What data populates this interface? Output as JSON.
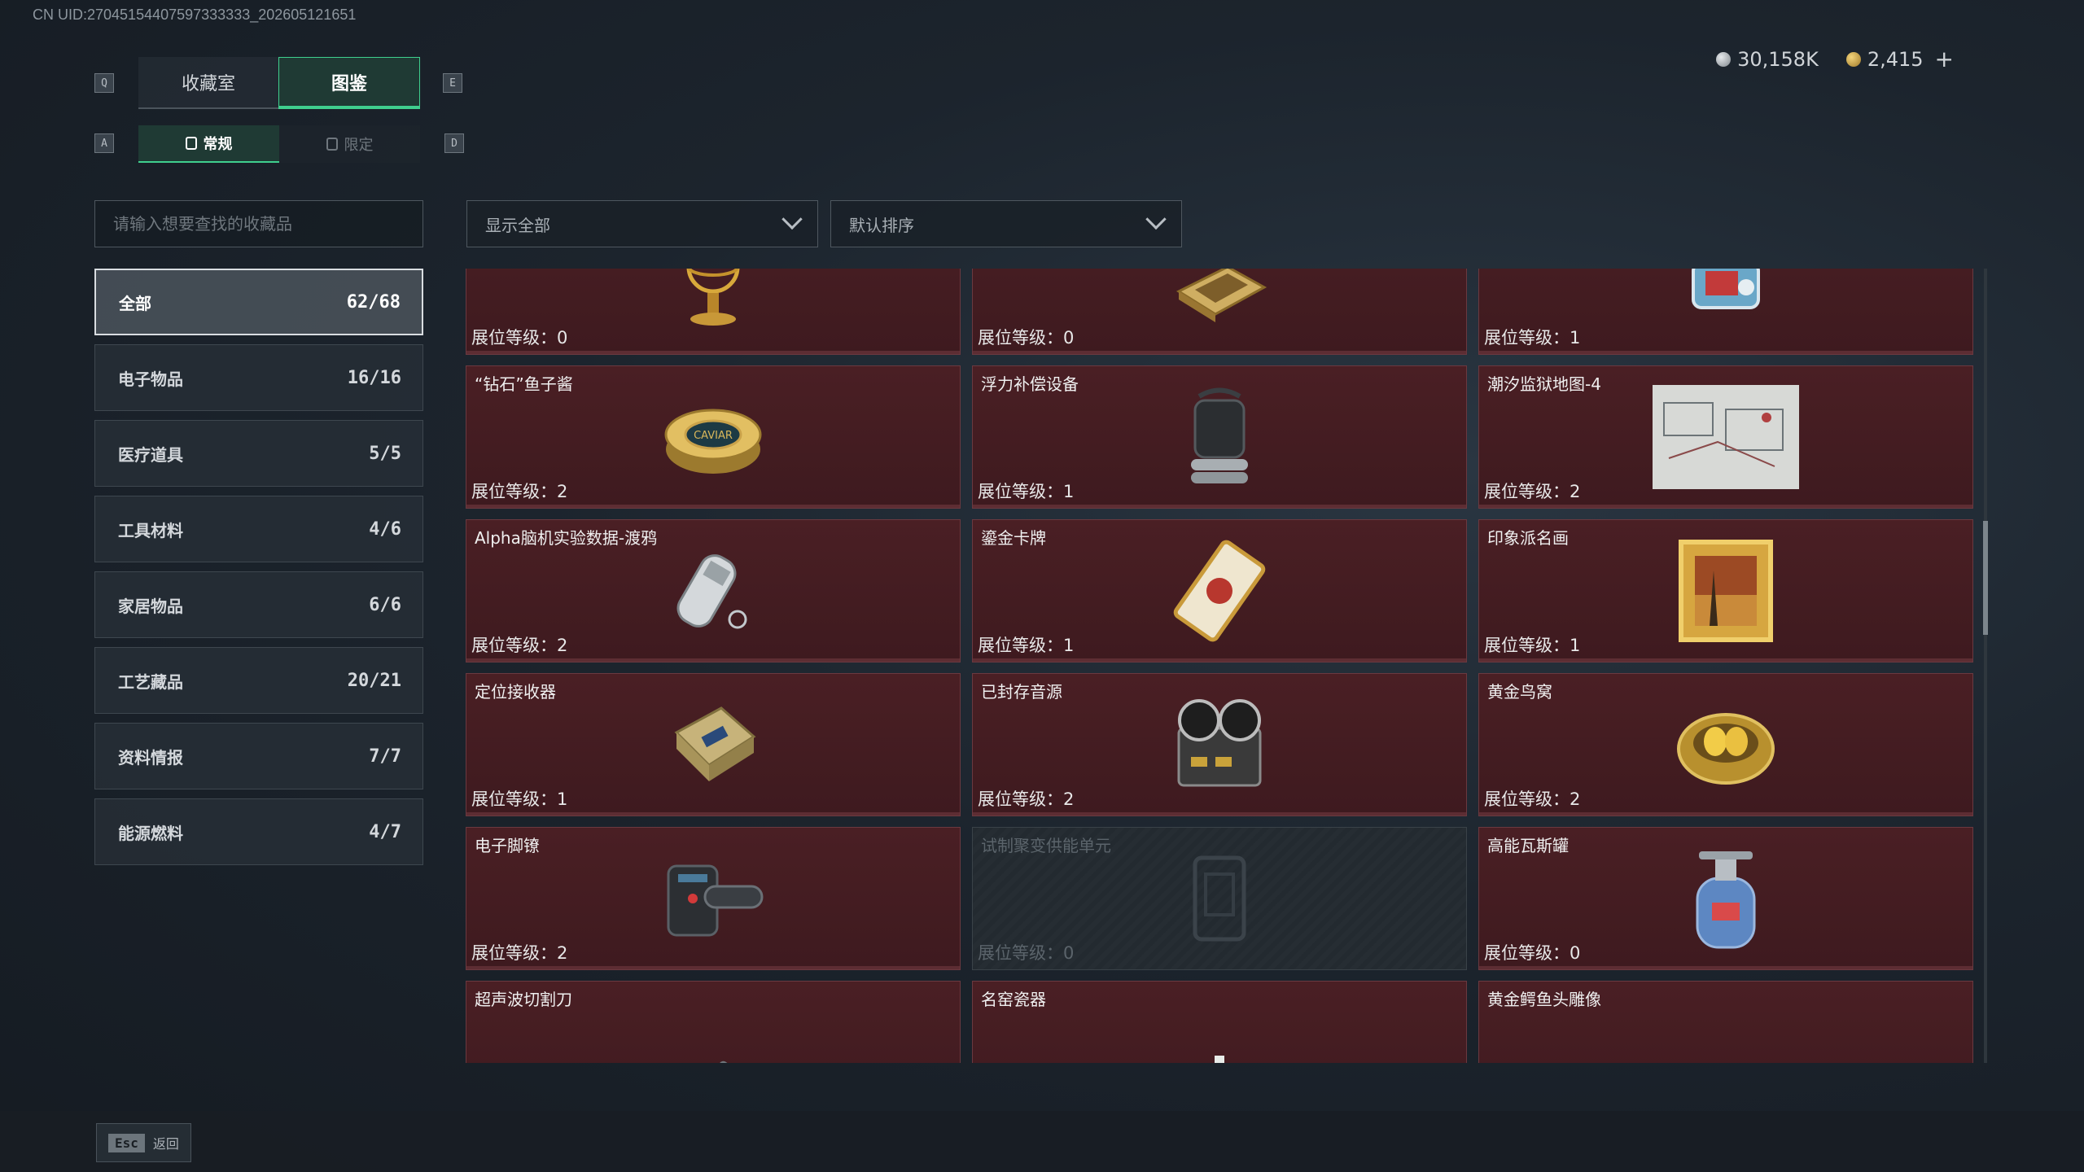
{
  "uid_text": "CN UID:27045154407597333333_202605121651",
  "keys": {
    "prev_tab": "Q",
    "next_tab": "E",
    "prev_sub": "A",
    "next_sub": "D"
  },
  "tabs": [
    {
      "label": "收藏室",
      "active": false
    },
    {
      "label": "图鉴",
      "active": true
    }
  ],
  "subtabs": [
    {
      "label": "常规",
      "active": true
    },
    {
      "label": "限定",
      "active": false
    }
  ],
  "currency": {
    "silver": "30,158K",
    "gold": "2,415",
    "add": "+"
  },
  "search": {
    "placeholder": "请输入想要查找的收藏品"
  },
  "filters": {
    "show": "显示全部",
    "sort": "默认排序"
  },
  "categories": [
    {
      "label": "全部",
      "count": "62/68",
      "active": true
    },
    {
      "label": "电子物品",
      "count": "16/16"
    },
    {
      "label": "医疗道具",
      "count": "5/5"
    },
    {
      "label": "工具材料",
      "count": "4/6"
    },
    {
      "label": "家居物品",
      "count": "6/6"
    },
    {
      "label": "工艺藏品",
      "count": "20/21"
    },
    {
      "label": "资料情报",
      "count": "7/7"
    },
    {
      "label": "能源燃料",
      "count": "4/7"
    }
  ],
  "level_prefix": "展位等级：",
  "items": [
    {
      "name": "",
      "level": "0",
      "icon": "armillary-sphere-icon"
    },
    {
      "name": "",
      "level": "0",
      "icon": "chess-board-icon"
    },
    {
      "name": "",
      "level": "1",
      "icon": "machine-icon"
    },
    {
      "name": "“钻石”鱼子酱",
      "level": "2",
      "icon": "caviar-tin-icon",
      "tin_label": "CAVIAR"
    },
    {
      "name": "浮力补偿设备",
      "level": "1",
      "icon": "bcd-vest-icon"
    },
    {
      "name": "潮汐监狱地图-4",
      "level": "2",
      "icon": "map-icon"
    },
    {
      "name": "Alpha脑机实验数据-渡鸦",
      "level": "2",
      "icon": "data-cylinder-icon"
    },
    {
      "name": "鎏金卡牌",
      "level": "1",
      "icon": "gold-card-icon"
    },
    {
      "name": "印象派名画",
      "level": "1",
      "icon": "framed-painting-icon"
    },
    {
      "name": "定位接收器",
      "level": "1",
      "icon": "receiver-icon"
    },
    {
      "name": "已封存音源",
      "level": "2",
      "icon": "reel-recorder-icon"
    },
    {
      "name": "黄金鸟窝",
      "level": "2",
      "icon": "golden-nest-icon"
    },
    {
      "name": "电子脚镣",
      "level": "2",
      "icon": "ankle-monitor-icon"
    },
    {
      "name": "试制聚变供能单元",
      "level": "0",
      "icon": "fusion-unit-icon",
      "locked": true
    },
    {
      "name": "高能瓦斯罐",
      "level": "0",
      "icon": "gas-canister-icon"
    },
    {
      "name": "超声波切割刀",
      "level": "",
      "icon": "cutter-icon"
    },
    {
      "name": "名窑瓷器",
      "level": "",
      "icon": "porcelain-icon"
    },
    {
      "name": "黄金鳄鱼头雕像",
      "level": "",
      "icon": "gold-croc-icon"
    }
  ],
  "footer": {
    "esc_key": "Esc",
    "back_label": "返回"
  },
  "colors": {
    "accent": "#3fcf8e",
    "card_bg": "#4a1f24"
  }
}
